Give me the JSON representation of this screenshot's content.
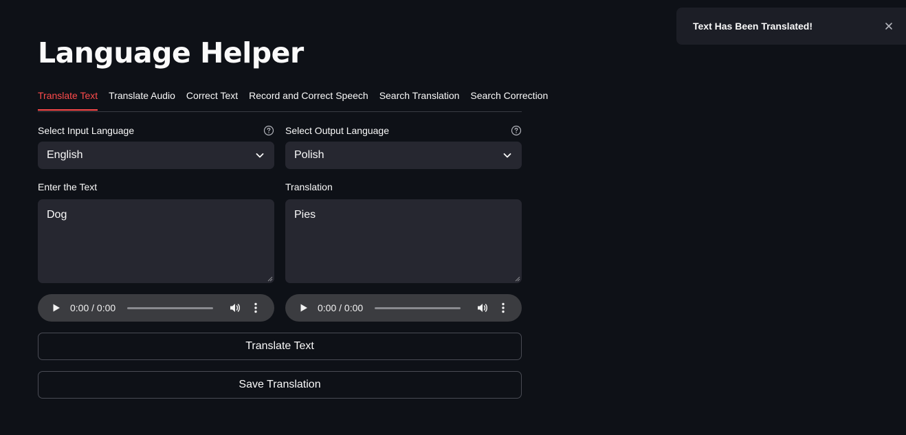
{
  "app": {
    "title": "Language Helper"
  },
  "tabs": [
    {
      "label": "Translate Text",
      "active": true
    },
    {
      "label": "Translate Audio",
      "active": false
    },
    {
      "label": "Correct Text",
      "active": false
    },
    {
      "label": "Record and Correct Speech",
      "active": false
    },
    {
      "label": "Search Translation",
      "active": false
    },
    {
      "label": "Search Correction",
      "active": false
    }
  ],
  "input_language": {
    "label": "Select Input Language",
    "selected": "English",
    "help_icon": "question-circle-icon"
  },
  "output_language": {
    "label": "Select Output Language",
    "selected": "Polish",
    "help_icon": "question-circle-icon"
  },
  "input_text": {
    "label": "Enter the Text",
    "value": "Dog"
  },
  "translation": {
    "label": "Translation",
    "value": "Pies"
  },
  "audio_input": {
    "time": "0:00 / 0:00"
  },
  "audio_output": {
    "time": "0:00 / 0:00"
  },
  "buttons": {
    "translate": "Translate Text",
    "save": "Save Translation"
  },
  "toast": {
    "message": "Text Has Been Translated!",
    "close_icon": "close-icon"
  },
  "colors": {
    "background": "#0e1117",
    "accent": "#ff4b4b",
    "widget": "#262730"
  }
}
